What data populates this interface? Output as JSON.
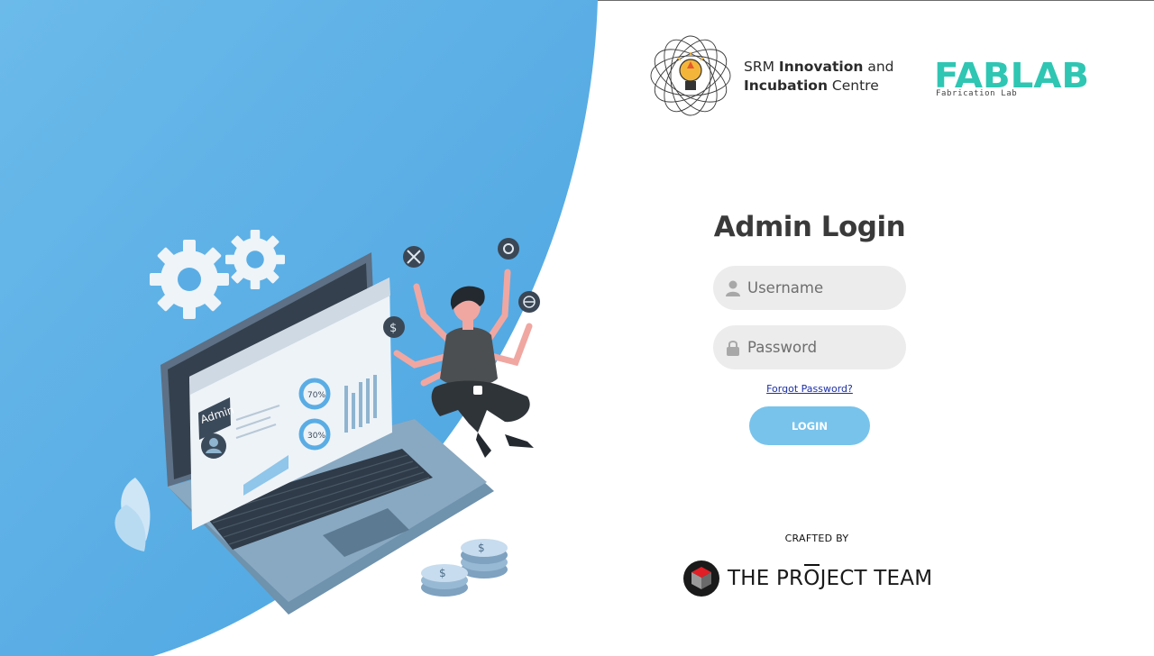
{
  "colors": {
    "hero_blue": "#5aade4",
    "login_button": "#78c3ec",
    "input_bg": "#ececec",
    "fablab_teal": "#2fc6b3",
    "link_blue": "#1b2fa8"
  },
  "header": {
    "srm": {
      "name_plain_1": "SRM ",
      "name_bold_1": "Innovation",
      "name_plain_2": " and",
      "name_bold_2": "Incubation",
      "name_plain_3": " Centre"
    },
    "fablab": {
      "logo_text": "FABLAB",
      "sub_label": "Fabrication Lab"
    }
  },
  "illustration": {
    "screen_title": "Admin",
    "stat_1": "70%",
    "stat_2": "30%",
    "icon_names": [
      "gear-icon",
      "gear-icon",
      "tools-icon",
      "settings-icon",
      "globe-icon",
      "dollar-icon"
    ]
  },
  "form": {
    "title": "Admin Login",
    "username_placeholder": "Username",
    "password_placeholder": "Password",
    "forgot_label": "Forgot Password?",
    "login_label": "LOGIN"
  },
  "footer": {
    "crafted_by": "CRAFTED BY",
    "team_before": "THE PR",
    "team_highlight": "O",
    "team_after": "JECT TEAM"
  }
}
